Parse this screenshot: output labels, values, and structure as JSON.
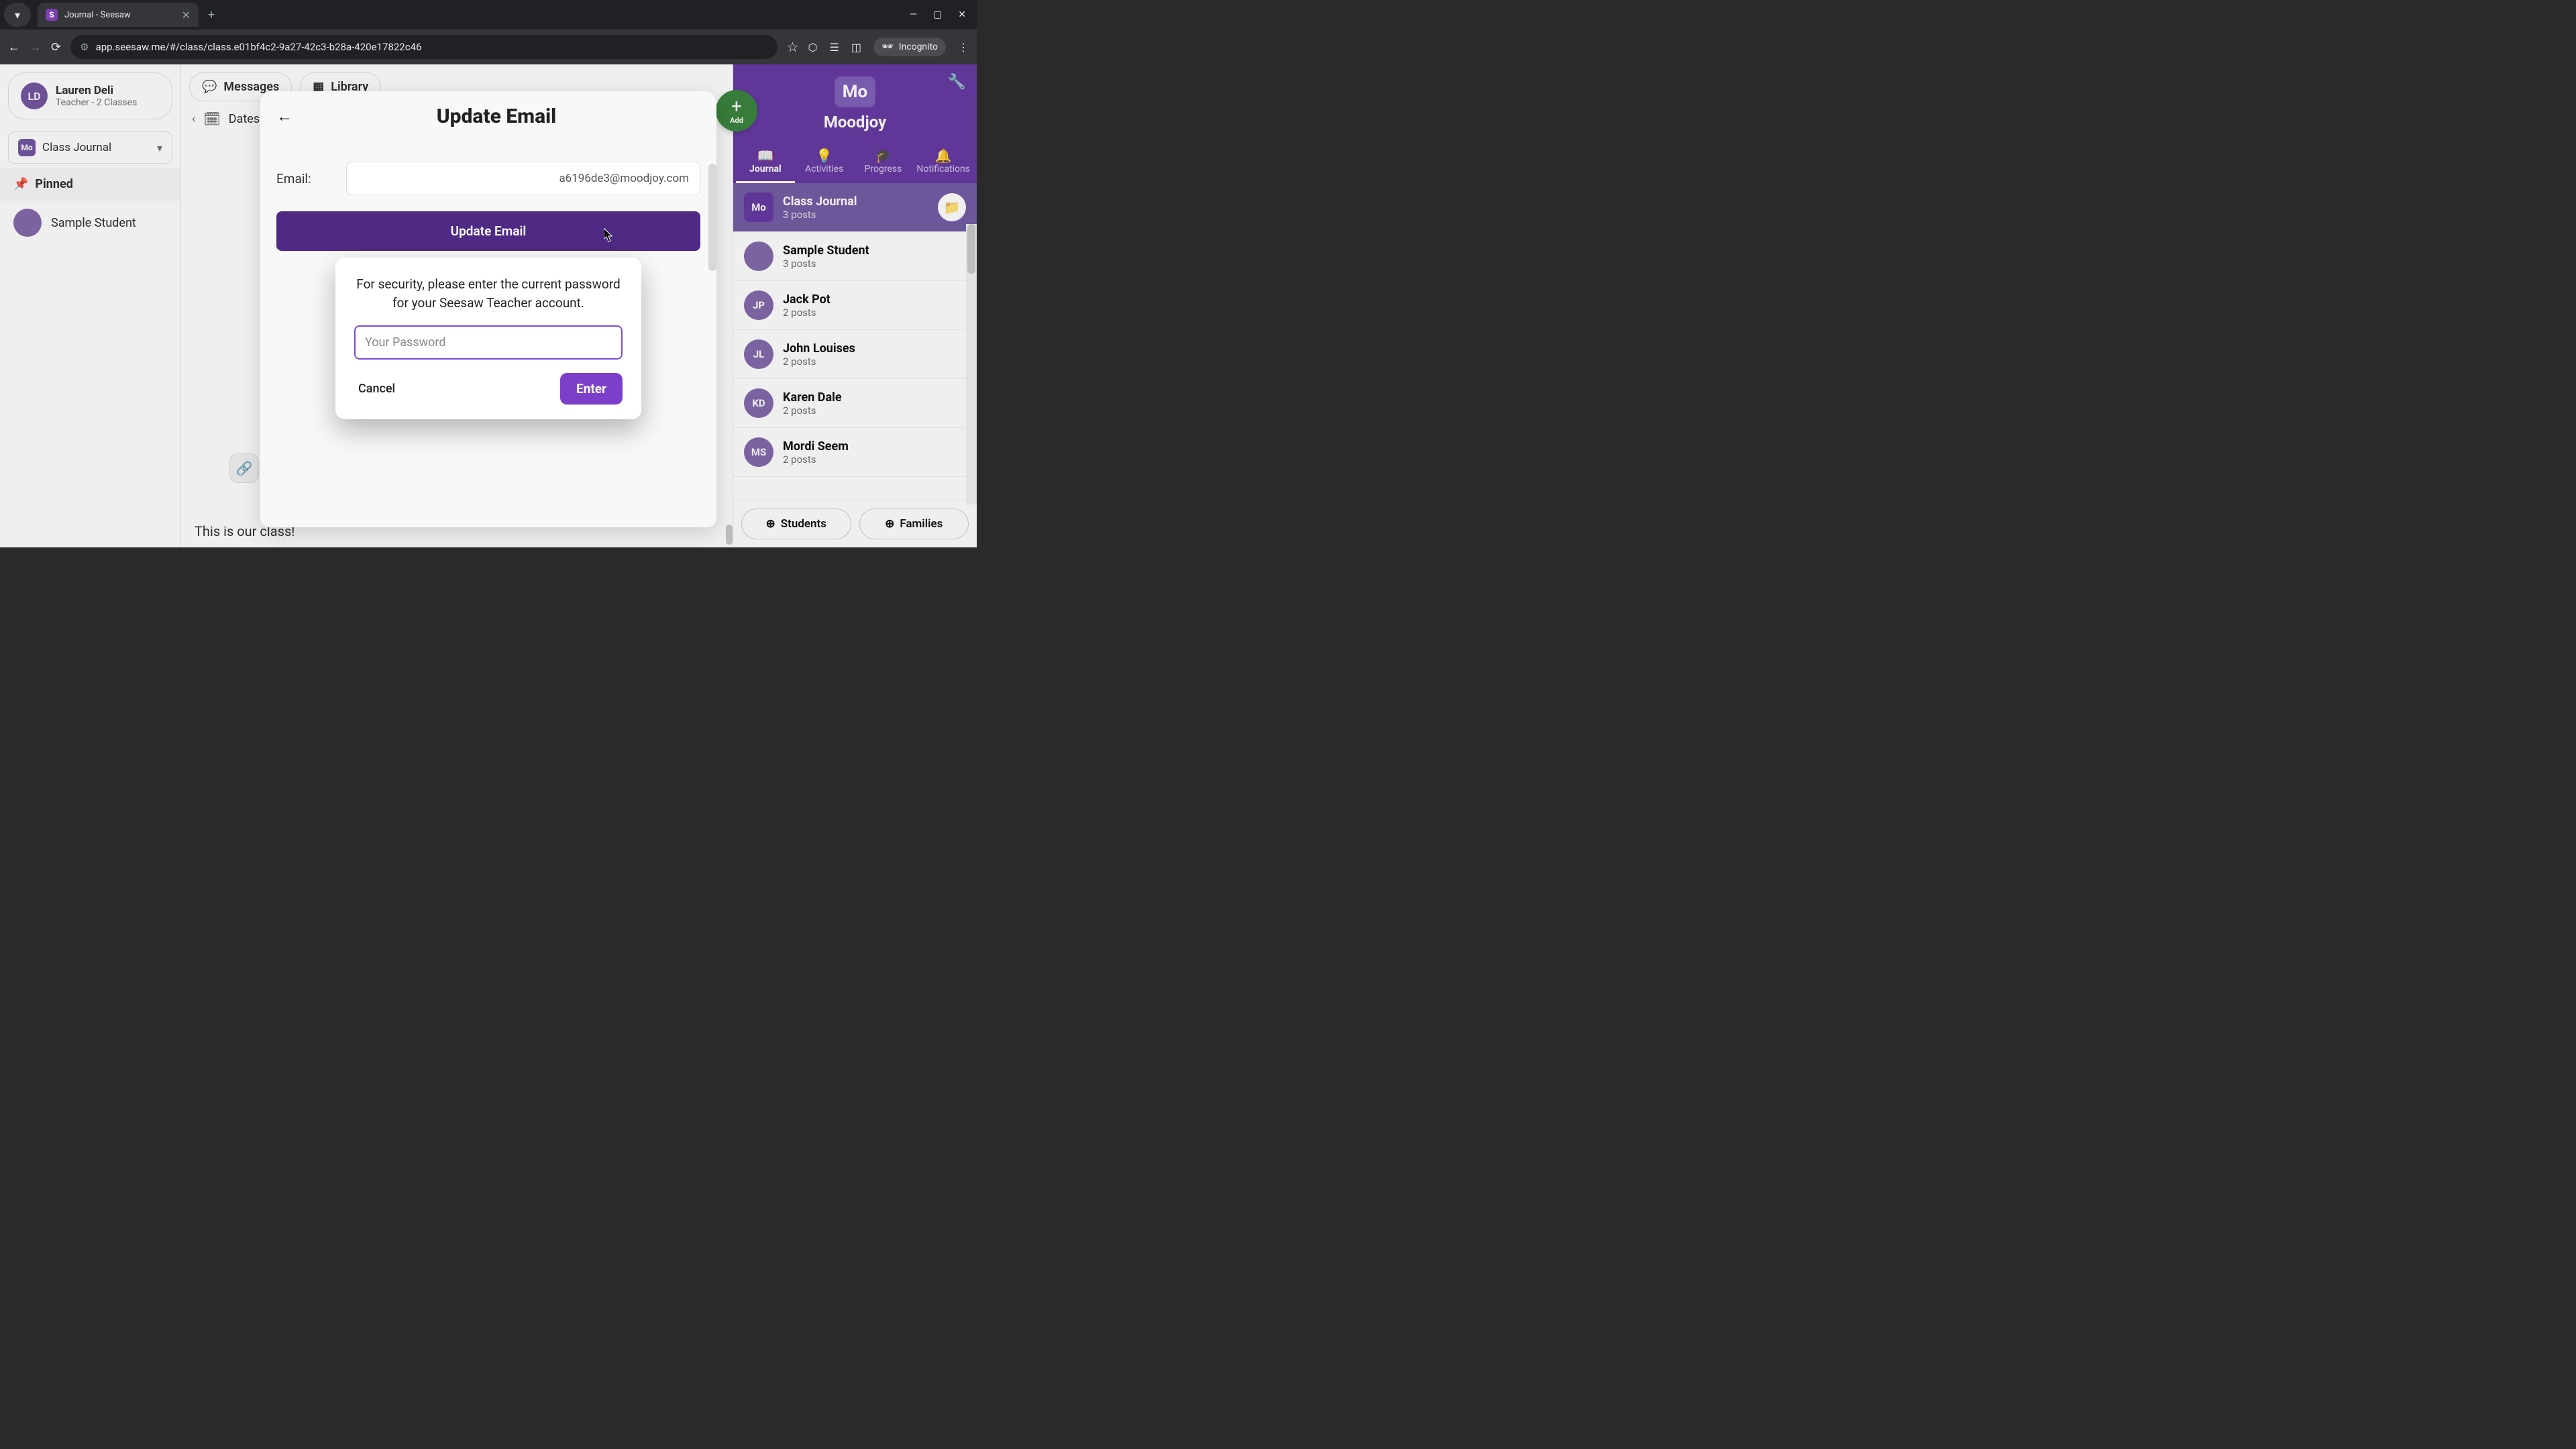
{
  "browser": {
    "tab_title": "Journal - Seesaw",
    "url": "app.seesaw.me/#/class/class.e01bf4c2-9a27-42c3-b28a-420e17822c46",
    "incognito_label": "Incognito"
  },
  "teacher": {
    "initials": "LD",
    "name": "Lauren Deli",
    "subtitle": "Teacher - 2 Classes"
  },
  "top_pills": {
    "messages": "Messages",
    "library": "Library"
  },
  "journal_selector": {
    "badge": "Mo",
    "label": "Class Journal"
  },
  "dates_label": "Dates",
  "pinned_label": "Pinned",
  "sample_student": "Sample Student",
  "feed_caption": "This is our class!",
  "right_header": {
    "badge": "Mo",
    "class_name": "Moodjoy",
    "add_label": "Add"
  },
  "right_tabs": {
    "journal": "Journal",
    "activities": "Activities",
    "progress": "Progress",
    "notifications": "Notifications"
  },
  "class_list": [
    {
      "avatar": "Mo",
      "avatar_style": "square",
      "title": "Class Journal",
      "sub": "3 posts",
      "active": true,
      "folder": true
    },
    {
      "avatar": "",
      "avatar_style": "photo",
      "title": "Sample Student",
      "sub": "3 posts"
    },
    {
      "avatar": "JP",
      "title": "Jack Pot",
      "sub": "2 posts"
    },
    {
      "avatar": "JL",
      "title": "John Louises",
      "sub": "2 posts"
    },
    {
      "avatar": "KD",
      "title": "Karen Dale",
      "sub": "2 posts"
    },
    {
      "avatar": "MS",
      "title": "Mordi Seem",
      "sub": "2 posts"
    }
  ],
  "right_footer": {
    "students": "Students",
    "families": "Families"
  },
  "update_panel": {
    "title": "Update Email",
    "email_label": "Email:",
    "email_value": "a6196de3@moodjoy.com",
    "button": "Update Email"
  },
  "password_modal": {
    "message": "For security, please enter the current password for your Seesaw Teacher account.",
    "placeholder": "Your Password",
    "cancel": "Cancel",
    "enter": "Enter"
  }
}
